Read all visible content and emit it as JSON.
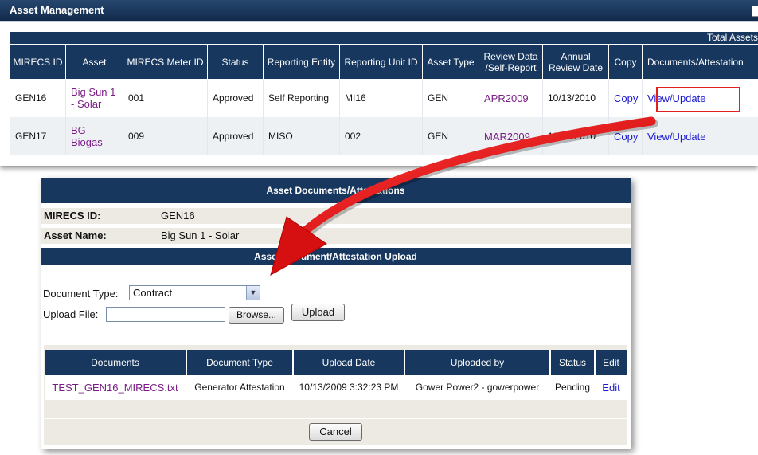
{
  "window": {
    "title": "Asset Management",
    "total_label": "Total Assets"
  },
  "assets_table": {
    "headers": [
      "MIRECS ID",
      "Asset",
      "MIRECS Meter ID",
      "Status",
      "Reporting Entity",
      "Reporting Unit ID",
      "Asset Type",
      "Review Data /Self-Report",
      "Annual Review Date",
      "Copy",
      "Documents/Attestation"
    ],
    "rows": [
      {
        "mirecs_id": "GEN16",
        "asset": "Big Sun 1 - Solar",
        "meter_id": "001",
        "status": "Approved",
        "entity": "Self Reporting",
        "unit_id": "MI16",
        "type": "GEN",
        "review": "APR2009",
        "annual_date": "10/13/2010",
        "copy": "Copy",
        "docs": "View/Update"
      },
      {
        "mirecs_id": "GEN17",
        "asset": "BG - Biogas",
        "meter_id": "009",
        "status": "Approved",
        "entity": "MISO",
        "unit_id": "002",
        "type": "GEN",
        "review": "MAR2009",
        "annual_date": "10/13/2010",
        "copy": "Copy",
        "docs": "View/Update"
      }
    ]
  },
  "doc_panel": {
    "title": "Asset Documents/Attestations",
    "mirecs_id_label": "MIRECS ID:",
    "mirecs_id_value": "GEN16",
    "asset_name_label": "Asset Name:",
    "asset_name_value": "Big Sun 1 - Solar",
    "upload_title": "Asset Document/Attestation Upload",
    "doc_type_label": "Document Type:",
    "doc_type_value": "Contract",
    "upload_file_label": "Upload File:",
    "upload_file_value": "",
    "browse_label": "Browse...",
    "upload_label": "Upload",
    "cancel_label": "Cancel",
    "docs_headers": [
      "Documents",
      "Document Type",
      "Upload Date",
      "Uploaded by",
      "Status",
      "Edit"
    ],
    "docs_rows": [
      {
        "document": "TEST_GEN16_MIRECS.txt",
        "type": "Generator Attestation",
        "date": "10/13/2009 3:32:23 PM",
        "by": "Gower Power2 - gowerpower",
        "status": "Pending",
        "edit": "Edit"
      }
    ]
  },
  "colors": {
    "header_navy": "#17375e",
    "link_purple": "#7a1d87",
    "link_blue": "#1b1bd0",
    "highlight_red": "#e02020",
    "panel_grey": "#eceae3"
  }
}
